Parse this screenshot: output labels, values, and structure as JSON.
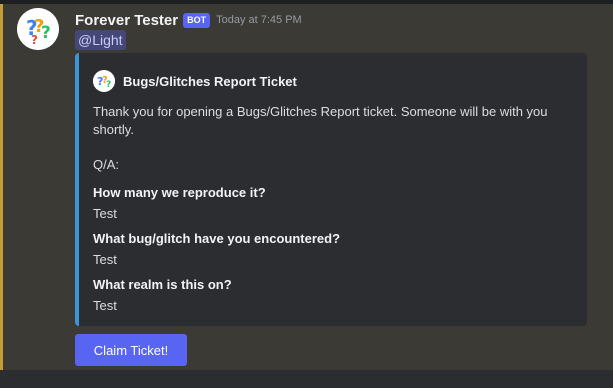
{
  "message": {
    "username": "Forever Tester",
    "bot_tag": "BOT",
    "timestamp": "Today at 7:45 PM",
    "mention": "@Light",
    "avatar_icon": "question-marks-logo-icon"
  },
  "embed": {
    "accent_color": "#3d94d6",
    "author_name": "Bugs/Glitches Report Ticket",
    "description": "Thank you for opening a Bugs/Glitches Report ticket. Someone will be with you shortly.",
    "qa_label": "Q/A:",
    "fields": [
      {
        "name": "How many we reproduce it?",
        "value": "Test"
      },
      {
        "name": "What bug/glitch have you encountered?",
        "value": "Test"
      },
      {
        "name": "What realm is this on?",
        "value": "Test"
      }
    ]
  },
  "buttons": {
    "claim_label": "Claim Ticket!"
  },
  "colors": {
    "brand": "#5865f2",
    "highlight": "#c69b3a"
  }
}
